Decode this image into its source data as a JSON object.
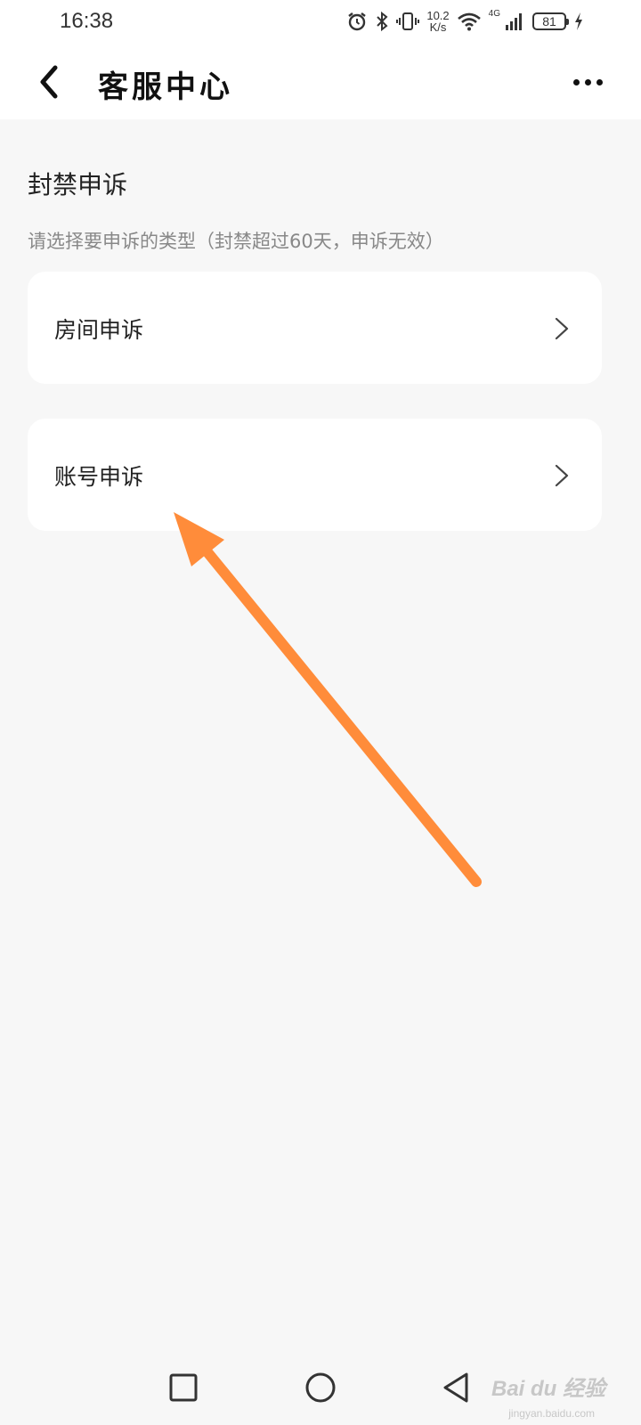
{
  "status_bar": {
    "time": "16:38",
    "net_speed_value": "10.2",
    "net_speed_unit": "K/s",
    "network_type": "4G",
    "battery": "81",
    "icons": [
      "alarm-icon",
      "bluetooth-icon",
      "vibrate-icon",
      "wifi-icon",
      "signal-icon",
      "battery-icon",
      "charging-icon"
    ]
  },
  "header": {
    "title": "客服中心",
    "back_icon": "chevron-left-icon",
    "more_icon": "more-icon"
  },
  "section": {
    "title": "封禁申诉",
    "hint": "请选择要申诉的类型（封禁超过60天，申诉无效）"
  },
  "options": [
    {
      "label": "房间申诉",
      "icon": "chevron-right-icon"
    },
    {
      "label": "账号申诉",
      "icon": "chevron-right-icon"
    }
  ],
  "annotation": {
    "color": "#ff8c3a"
  },
  "nav": {
    "icons": [
      "recent-apps-icon",
      "home-icon",
      "back-icon"
    ]
  },
  "watermark": {
    "text": "Bai du 经验",
    "sub": "jingyan.baidu.com"
  },
  "colors": {
    "background": "#f7f7f7",
    "card": "#ffffff",
    "hint": "#888888",
    "arrow": "#ff8c3a"
  }
}
